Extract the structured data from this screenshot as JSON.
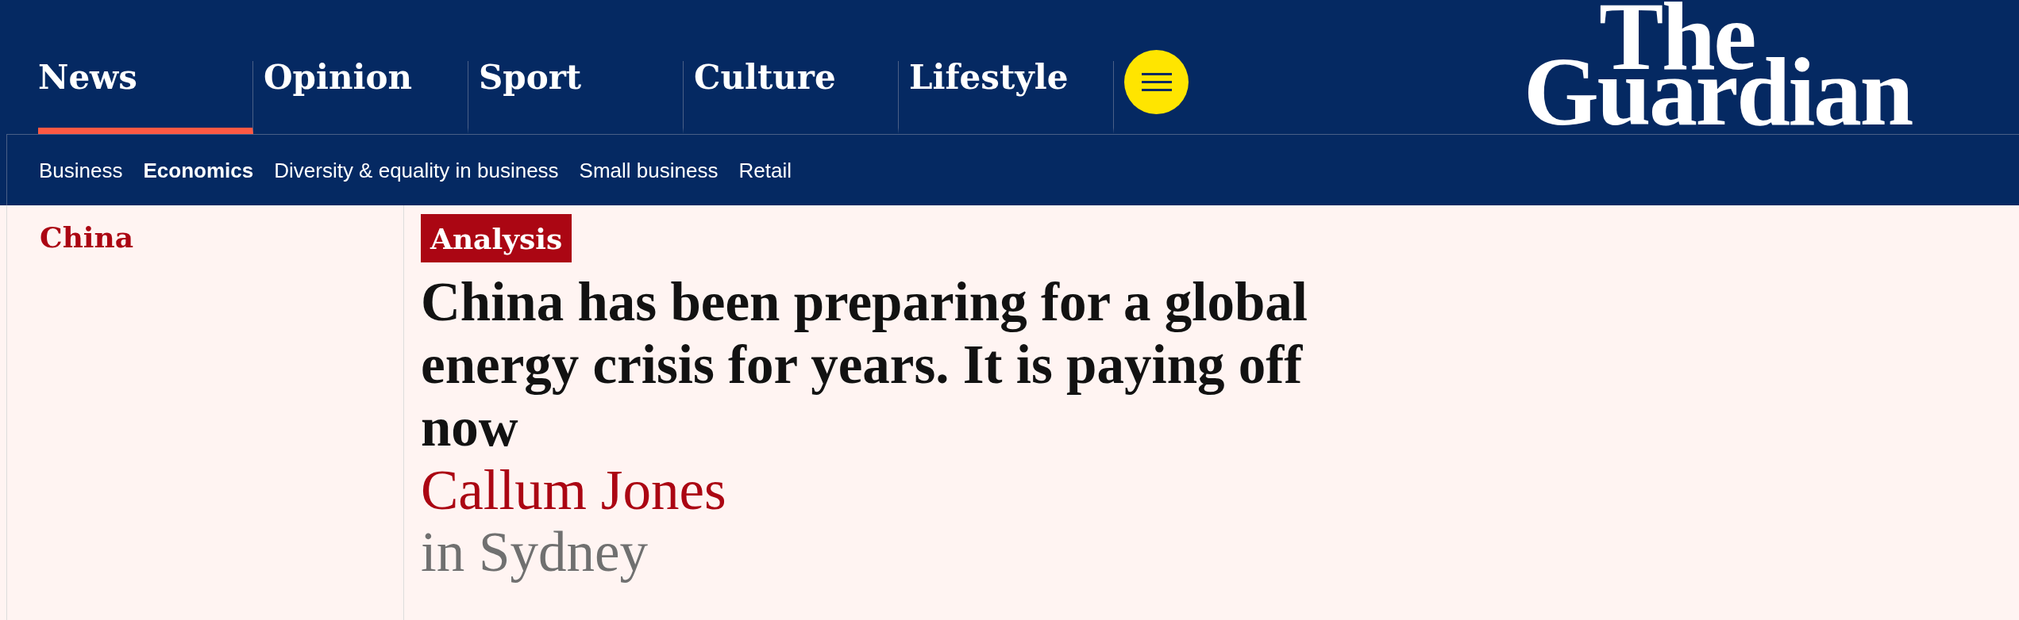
{
  "header": {
    "pillars": [
      {
        "label": "News",
        "selected": true
      },
      {
        "label": "Opinion",
        "selected": false
      },
      {
        "label": "Sport",
        "selected": false
      },
      {
        "label": "Culture",
        "selected": false
      },
      {
        "label": "Lifestyle",
        "selected": false
      }
    ],
    "logo": {
      "line_1": "The",
      "line_2": "Guardian"
    }
  },
  "subnav": {
    "items": [
      {
        "label": "Business",
        "selected": false
      },
      {
        "label": "Economics",
        "selected": true
      },
      {
        "label": "Diversity & equality in business",
        "selected": false
      },
      {
        "label": "Small business",
        "selected": false
      },
      {
        "label": "Retail",
        "selected": false
      }
    ]
  },
  "article": {
    "series": "China",
    "format_label": "Analysis",
    "headline": "China has been preparing for a global energy crisis for years. It is paying off now",
    "byline": {
      "author": "Callum Jones",
      "location": "in Sydney"
    }
  }
}
